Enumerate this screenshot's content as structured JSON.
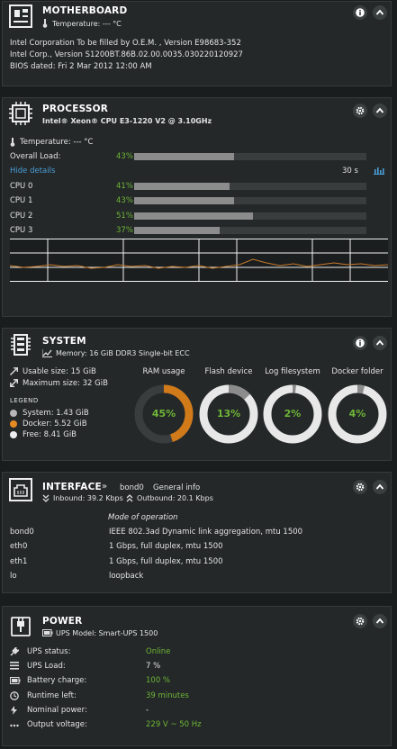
{
  "motherboard": {
    "title": "MOTHERBOARD",
    "temperature": "Temperature: --- °C",
    "lines": [
      "Intel Corporation To be filled by O.E.M. , Version E98683-352",
      "Intel Corp., Version S1200BT.86B.02.00.0035.030220120927",
      "BIOS dated: Fri 2 Mar 2012 12:00 AM"
    ]
  },
  "processor": {
    "title": "PROCESSOR",
    "model": "Intel® Xeon® CPU E3-1220 V2 @ 3.10GHz",
    "temperature": "Temperature: --- °C",
    "overall_label": "Overall Load:",
    "overall_pct": "43%",
    "overall_value": 0.43,
    "hide_details": "Hide details",
    "interval": "30 s",
    "cpus": [
      {
        "label": "CPU 0",
        "pct": "41%",
        "value": 0.41
      },
      {
        "label": "CPU 1",
        "pct": "43%",
        "value": 0.43
      },
      {
        "label": "CPU 2",
        "pct": "51%",
        "value": 0.51
      },
      {
        "label": "CPU 3",
        "pct": "37%",
        "value": 0.37
      }
    ]
  },
  "system": {
    "title": "SYSTEM",
    "memory": "Memory: 16 GiB DDR3 Single-bit ECC",
    "usable": "Usable size: 15 GiB",
    "maximum": "Maximum size: 32 GiB",
    "legend_title": "LEGEND",
    "legend": [
      {
        "label": "System: 1.43 GiB",
        "color": "#b7b7b7"
      },
      {
        "label": "Docker: 5.52 GiB",
        "color": "#e68a23"
      },
      {
        "label": "Free: 8.41 GiB",
        "color": "#eeeeee"
      }
    ],
    "gauges": [
      {
        "label": "RAM usage",
        "pct": "45%",
        "value": 0.45,
        "color": "#d07a1a",
        "track": "#3a3d3e"
      },
      {
        "label": "Flash device",
        "pct": "13%",
        "value": 0.13,
        "color": "#8c8c8c",
        "track": "#e8e8e8"
      },
      {
        "label": "Log filesystem",
        "pct": "2%",
        "value": 0.02,
        "color": "#8c8c8c",
        "track": "#e8e8e8"
      },
      {
        "label": "Docker folder",
        "pct": "4%",
        "value": 0.04,
        "color": "#8c8c8c",
        "track": "#e8e8e8"
      }
    ]
  },
  "interface": {
    "title": "INTERFACE",
    "separator": "»",
    "selected": "bond0",
    "info": "General info",
    "inbound": "Inbound: 39.2 Kbps",
    "outbound": "Outbound: 20.1 Kbps",
    "column_header": "Mode of operation",
    "rows": [
      {
        "name": "bond0",
        "mode": "IEEE 802.3ad Dynamic link aggregation, mtu 1500"
      },
      {
        "name": "eth0",
        "mode": "1 Gbps, full duplex, mtu 1500"
      },
      {
        "name": "eth1",
        "mode": "1 Gbps, full duplex, mtu 1500"
      },
      {
        "name": "lo",
        "mode": "loopback"
      }
    ]
  },
  "power": {
    "title": "POWER",
    "model": "UPS Model: Smart-UPS 1500",
    "rows": [
      {
        "label": "UPS status:",
        "value": "Online",
        "green": true,
        "icon": "plug-icon"
      },
      {
        "label": "UPS Load:",
        "value": "7 %",
        "green": false,
        "icon": "list-icon"
      },
      {
        "label": "Battery charge:",
        "value": "100 %",
        "green": true,
        "icon": "battery-icon"
      },
      {
        "label": "Runtime left:",
        "value": "39 minutes",
        "green": true,
        "icon": "clock-icon"
      },
      {
        "label": "Nominal power:",
        "value": "-",
        "green": false,
        "icon": "bolt-icon"
      },
      {
        "label": "Output voltage:",
        "value": "229 V ~ 50 Hz",
        "green": true,
        "icon": "dots-icon"
      }
    ]
  }
}
